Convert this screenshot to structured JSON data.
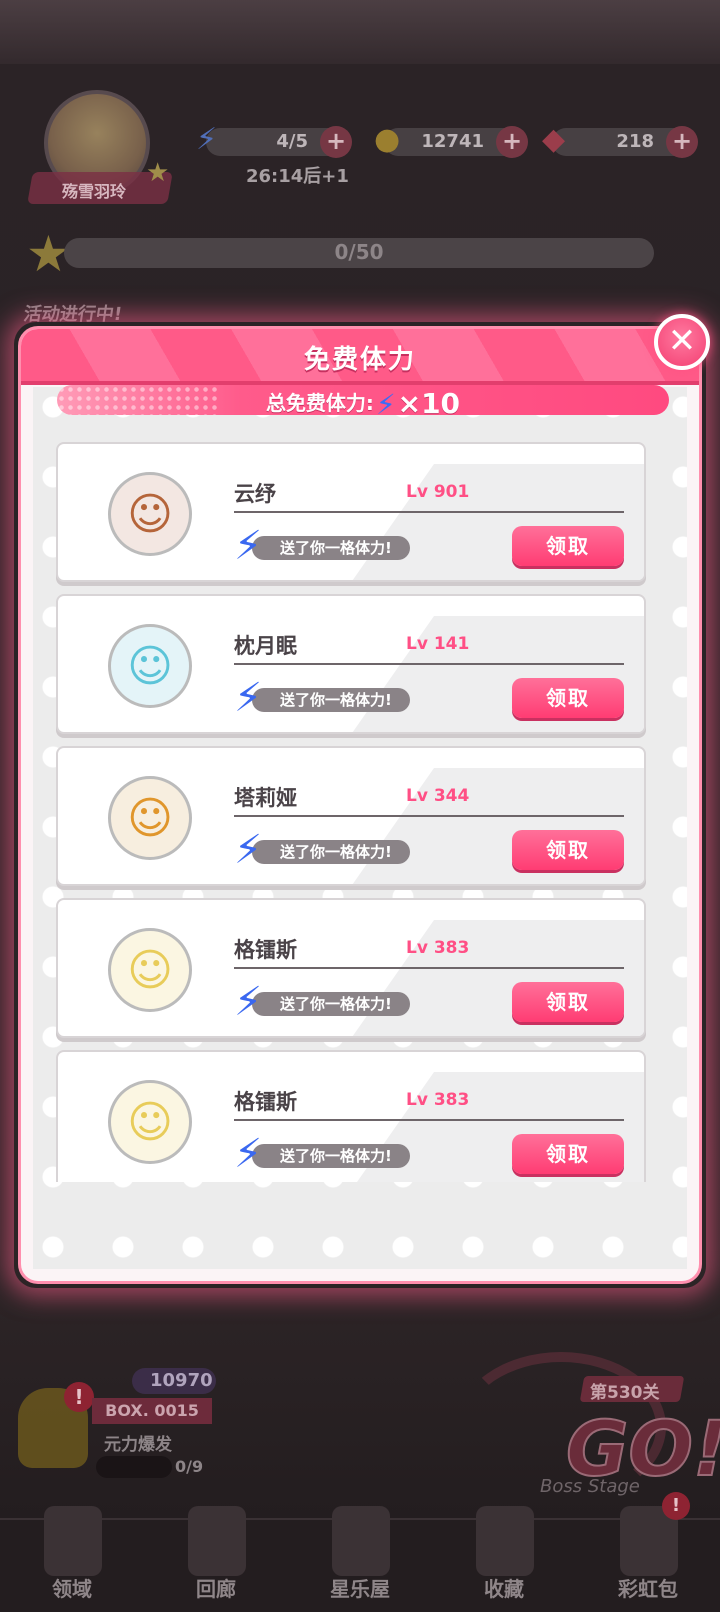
{
  "background": {
    "player_name": "殇雪羽玲",
    "stamina": "4/5",
    "coins": "12741",
    "gems": "218",
    "timer": "26:14后+1",
    "progress": "0/50",
    "event_text": "活动进行中!",
    "bottom_stamina": "10970",
    "box_label": "BOX. 0015",
    "box_title": "元力爆发",
    "box_count": "0/9",
    "stage_label": "第530关",
    "go_label": "GO!",
    "boss_stage": "Boss Stage",
    "nav": [
      "领域",
      "回廊",
      "星乐屋",
      "收藏",
      "彩虹包"
    ]
  },
  "modal": {
    "title": "免费体力",
    "total_label": "总免费体力:",
    "total_count": "×10",
    "accent_color": "#ff4a80"
  },
  "friends": [
    {
      "name": "云纾",
      "level": "Lv 901",
      "message": "送了你一格体力!",
      "button": "领取"
    },
    {
      "name": "枕月眠",
      "level": "Lv 141",
      "message": "送了你一格体力!",
      "button": "领取"
    },
    {
      "name": "塔莉娅",
      "level": "Lv 344",
      "message": "送了你一格体力!",
      "button": "领取"
    },
    {
      "name": "格镭斯",
      "level": "Lv 383",
      "message": "送了你一格体力!",
      "button": "领取"
    },
    {
      "name": "格镭斯",
      "level": "Lv 383",
      "message": "送了你一格体力!",
      "button": "领取"
    }
  ]
}
